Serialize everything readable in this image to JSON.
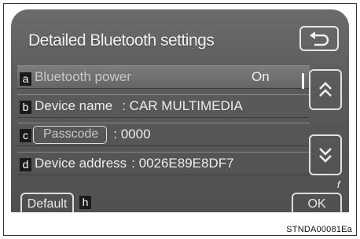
{
  "screen": {
    "title": "Detailed Bluetooth settings",
    "back_icon": "return-arrow-icon"
  },
  "rows": [
    {
      "tag": "a",
      "label": "Bluetooth power",
      "value": "On"
    },
    {
      "tag": "b",
      "label": "Device name",
      "value": ": CAR MULTIMEDIA"
    },
    {
      "tag": "c",
      "label": "Passcode",
      "value": ": 0000"
    },
    {
      "tag": "d",
      "label": "Device address",
      "value": ": 0026E89E8DF7"
    }
  ],
  "scroll": {
    "up_icon": "double-chevron-up-icon",
    "down_icon": "double-chevron-down-icon"
  },
  "bottom": {
    "default_label": "Default",
    "default_tag": "h",
    "ok_label": "OK",
    "ok_tag": "f"
  },
  "caption": "STNDA00081Ea"
}
